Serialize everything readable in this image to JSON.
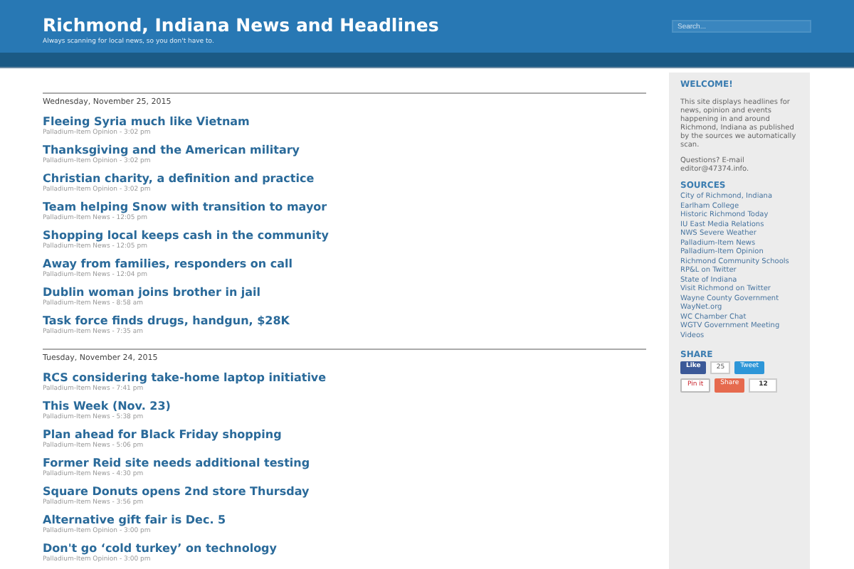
{
  "header": {
    "title": "Richmond, Indiana News and Headlines",
    "tagline": "Always scanning for local news, so you don't have to.",
    "search": {
      "placeholder": "Search..."
    }
  },
  "days": [
    {
      "date": "Wednesday, November 25, 2015",
      "items": [
        {
          "title": "Fleeing Syria much like Vietnam",
          "meta": "Palladium-Item Opinion - 3:02 pm"
        },
        {
          "title": "Thanksgiving and the American military",
          "meta": "Palladium-Item Opinion - 3:02 pm"
        },
        {
          "title": "Christian charity, a definition and practice",
          "meta": "Palladium-Item Opinion - 3:02 pm"
        },
        {
          "title": "Team helping Snow with transition to mayor",
          "meta": "Palladium-Item News - 12:05 pm"
        },
        {
          "title": "Shopping local keeps cash in the community",
          "meta": "Palladium-Item News - 12:05 pm"
        },
        {
          "title": "Away from families, responders on call",
          "meta": "Palladium-Item News - 12:04 pm"
        },
        {
          "title": "Dublin woman joins brother in jail",
          "meta": "Palladium-Item News - 8:58 am"
        },
        {
          "title": "Task force finds drugs, handgun, $28K",
          "meta": "Palladium-Item News - 7:35 am"
        }
      ]
    },
    {
      "date": "Tuesday, November 24, 2015",
      "items": [
        {
          "title": "RCS considering take-home laptop initiative",
          "meta": "Palladium-Item News - 7:41 pm"
        },
        {
          "title": "This Week (Nov. 23)",
          "meta": "Palladium-Item News - 5:38 pm"
        },
        {
          "title": "Plan ahead for Black Friday shopping",
          "meta": "Palladium-Item News - 5:06 pm"
        },
        {
          "title": "Former Reid site needs additional testing",
          "meta": "Palladium-Item News - 4:30 pm"
        },
        {
          "title": "Square Donuts opens 2nd store Thursday",
          "meta": "Palladium-Item News - 3:56 pm"
        },
        {
          "title": "Alternative gift fair is Dec. 5",
          "meta": "Palladium-Item Opinion - 3:00 pm"
        },
        {
          "title": "Don't go ‘cold turkey’ on technology",
          "meta": "Palladium-Item Opinion - 3:00 pm"
        }
      ]
    }
  ],
  "sidebar": {
    "welcome": {
      "heading": "WELCOME!",
      "text": "This site displays headlines for news, opinion and events happening in and around Richmond, Indiana as published by the sources we automatically scan.",
      "contact": "Questions? E-mail editor@47374.info."
    },
    "sources": {
      "heading": "SOURCES",
      "items": [
        "City of Richmond, Indiana",
        "Earlham College",
        "Historic Richmond Today",
        "IU East Media Relations",
        "NWS Severe Weather",
        "Palladium-Item News",
        "Palladium-Item Opinion",
        "Richmond Community Schools",
        "RP&L on Twitter",
        "State of Indiana",
        "Visit Richmond on Twitter",
        "Wayne County Government",
        "WayNet.org",
        "WC Chamber Chat",
        "WGTV Government Meeting Videos"
      ]
    },
    "share": {
      "heading": "SHARE",
      "like": "Like",
      "like_count": "25",
      "tweet": "Tweet",
      "pin": "Pin it",
      "share": "Share",
      "share_count": "12"
    }
  }
}
